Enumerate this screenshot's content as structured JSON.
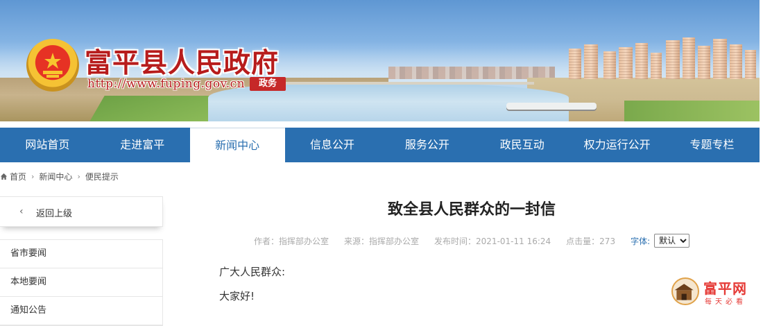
{
  "header": {
    "site_title": "富平县人民政府",
    "site_url": "http://www.fuping.gov.cn",
    "site_tag": "政务"
  },
  "nav": {
    "items": [
      "网站首页",
      "走进富平",
      "新闻中心",
      "信息公开",
      "服务公开",
      "政民互动",
      "权力运行公开",
      "专题专栏"
    ],
    "active": "新闻中心"
  },
  "breadcrumb": {
    "items": [
      "首页",
      "新闻中心",
      "便民提示"
    ]
  },
  "sidebar": {
    "back_label": "返回上级",
    "items": [
      "省市要闻",
      "本地要闻",
      "通知公告"
    ]
  },
  "article": {
    "title": "致全县人民群众的一封信",
    "author": "作者：指挥部办公室",
    "source": "来源：指挥部办公室",
    "published": "发布时间：2021-01-11 16:24",
    "hits": "点击量：273",
    "font_label": "字体:",
    "font_selected": "默认",
    "salutation": "广大人民群众:",
    "greeting": "大家好!"
  },
  "floating_logo": {
    "text": "富平网",
    "sub": "每天必看"
  },
  "colors": {
    "nav_bg": "#2a6fb0",
    "title_red": "#b71c1c",
    "accent_red": "#e53935"
  }
}
